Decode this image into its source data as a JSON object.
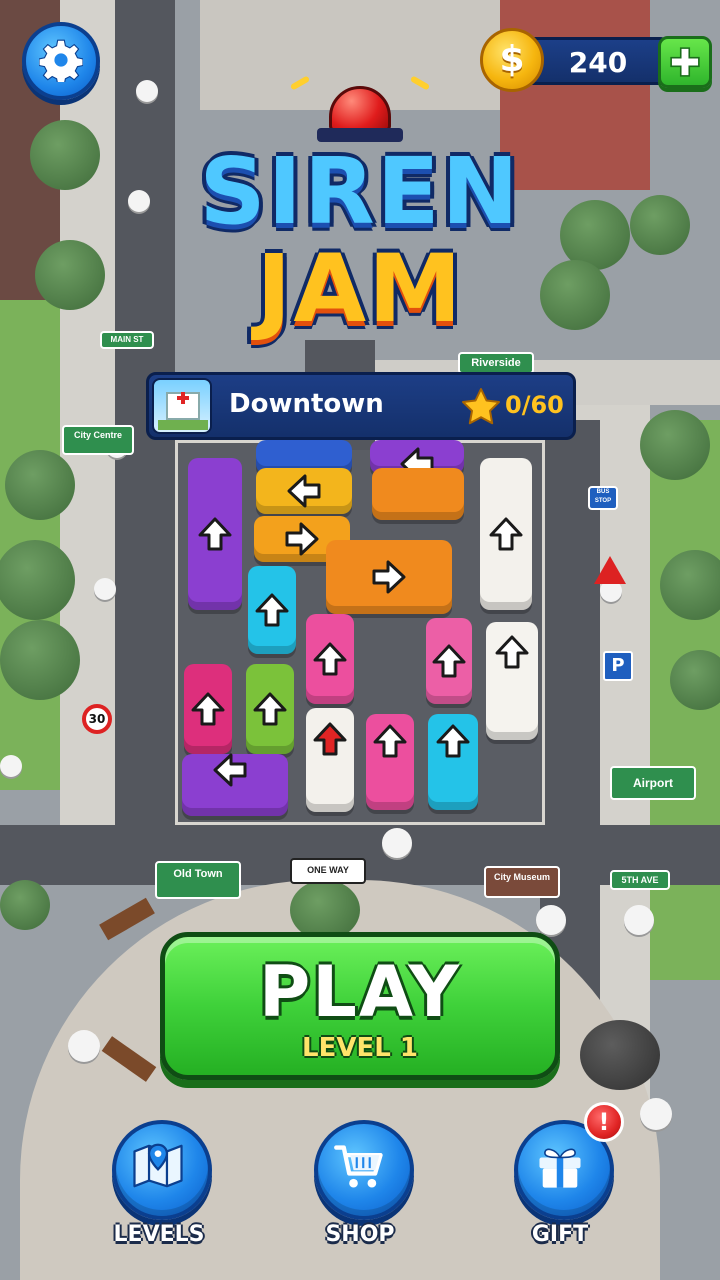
{
  "coins": {
    "value": "240"
  },
  "title": {
    "line1": "SIREN",
    "line2": "JAM"
  },
  "location": {
    "name": "Downtown",
    "stars": "0/60"
  },
  "play": {
    "label": "PLAY",
    "sublabel": "LEVEL 1"
  },
  "nav": {
    "levels": "LEVELS",
    "shop": "SHOP",
    "gift": "GIFT",
    "gift_badge": "!"
  },
  "street_signs": {
    "main_st": "MAIN ST",
    "riverside": "Riverside",
    "city_centre": "City Centre",
    "airport": "Airport",
    "old_town": "Old Town",
    "one_way": "ONE WAY",
    "city_museum": "City Museum",
    "fifth_ave": "5TH AVE",
    "bus_stop": "BUS STOP",
    "speed_limit": "30",
    "parking": "P"
  },
  "icons": {
    "settings": "gear-icon",
    "coin": "coin-icon",
    "add": "plus-icon",
    "star": "star-icon",
    "levels": "map-icon",
    "shop": "cart-icon",
    "gift": "gift-icon"
  },
  "colors": {
    "play_green": "#3fd13a",
    "hud_blue": "#1f86ea",
    "banner_navy": "#14306b",
    "coin_gold": "#f6b60f",
    "badge_red": "#e02424"
  }
}
